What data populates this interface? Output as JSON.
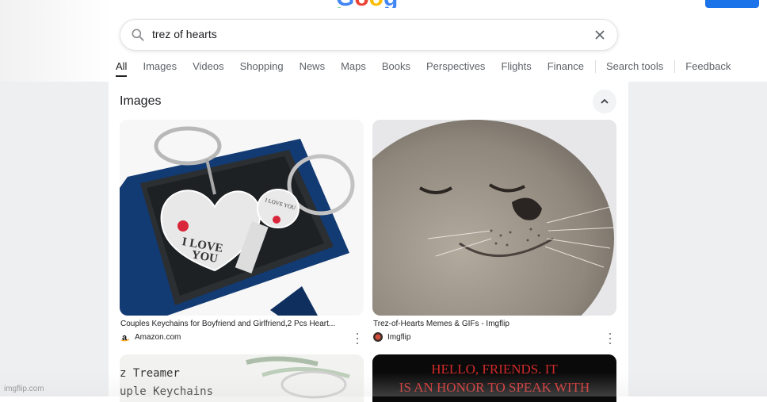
{
  "header": {
    "logo_text": "Google",
    "logo_letters": [
      {
        "char": "G",
        "color": "#4285f4"
      },
      {
        "char": "o",
        "color": "#ea4335"
      },
      {
        "char": "o",
        "color": "#fbbc05"
      },
      {
        "char": "g",
        "color": "#4285f4"
      },
      {
        "char": "l",
        "color": "#34a853"
      },
      {
        "char": "e",
        "color": "#ea4335"
      }
    ],
    "accent_color": "#1a73e8"
  },
  "search": {
    "query": "trez of hearts",
    "search_icon": "search-icon",
    "clear_icon": "close-icon"
  },
  "tabs": {
    "all": "All",
    "images": "Images",
    "videos": "Videos",
    "shopping": "Shopping",
    "news": "News",
    "maps": "Maps",
    "books": "Books",
    "perspectives": "Perspectives",
    "flights": "Flights",
    "finance": "Finance",
    "search_tools": "Search tools",
    "feedback": "Feedback"
  },
  "images_section": {
    "title": "Images",
    "collapse_icon": "chevron-up-icon",
    "results": [
      {
        "title": "Couples Keychains for Boyfriend and Girlfriend,2 Pcs Heart...",
        "source": "Amazon.com",
        "thumb_text": [
          "I LOVE",
          "YOU"
        ],
        "key_text": "I LOVE YOU"
      },
      {
        "title": "Trez-of-Hearts Memes & GIFs - Imgflip",
        "source": "Imgflip"
      },
      {
        "thumb_text": [
          "z Treamer",
          "uple Keychains"
        ]
      },
      {
        "thumb_text": [
          "HELLO, FRIENDS. IT",
          "IS AN HONOR TO SPEAK WITH"
        ]
      }
    ]
  },
  "watermark": "imgflip.com"
}
